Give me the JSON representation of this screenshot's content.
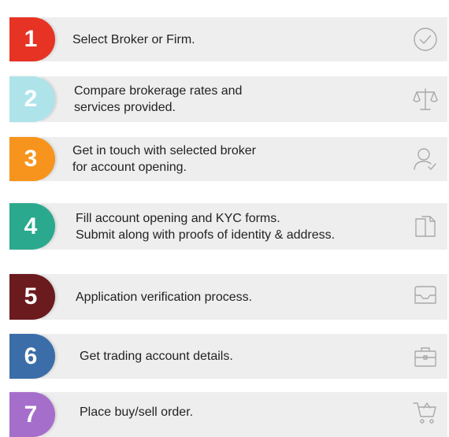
{
  "steps": [
    {
      "number": "1",
      "text": "Select Broker or Firm.",
      "color": "#e63324",
      "icon": "check-circle-icon"
    },
    {
      "number": "2",
      "text": "Compare brokerage rates and\nservices provided.",
      "color": "#aee3ea",
      "icon": "scales-icon"
    },
    {
      "number": "3",
      "text": "Get in touch with selected broker\nfor account opening.",
      "color": "#f7941d",
      "icon": "user-check-icon"
    },
    {
      "number": "4",
      "text": "Fill account opening and KYC forms.\nSubmit along with proofs of identity & address.",
      "color": "#2ba98e",
      "icon": "documents-icon"
    },
    {
      "number": "5",
      "text": "Application verification process.",
      "color": "#6b1a1e",
      "icon": "inbox-icon"
    },
    {
      "number": "6",
      "text": "Get trading account details.",
      "color": "#3b6ea8",
      "icon": "briefcase-icon"
    },
    {
      "number": "7",
      "text": "Place buy/sell order.",
      "color": "#a66ecb",
      "icon": "cart-icon"
    }
  ]
}
